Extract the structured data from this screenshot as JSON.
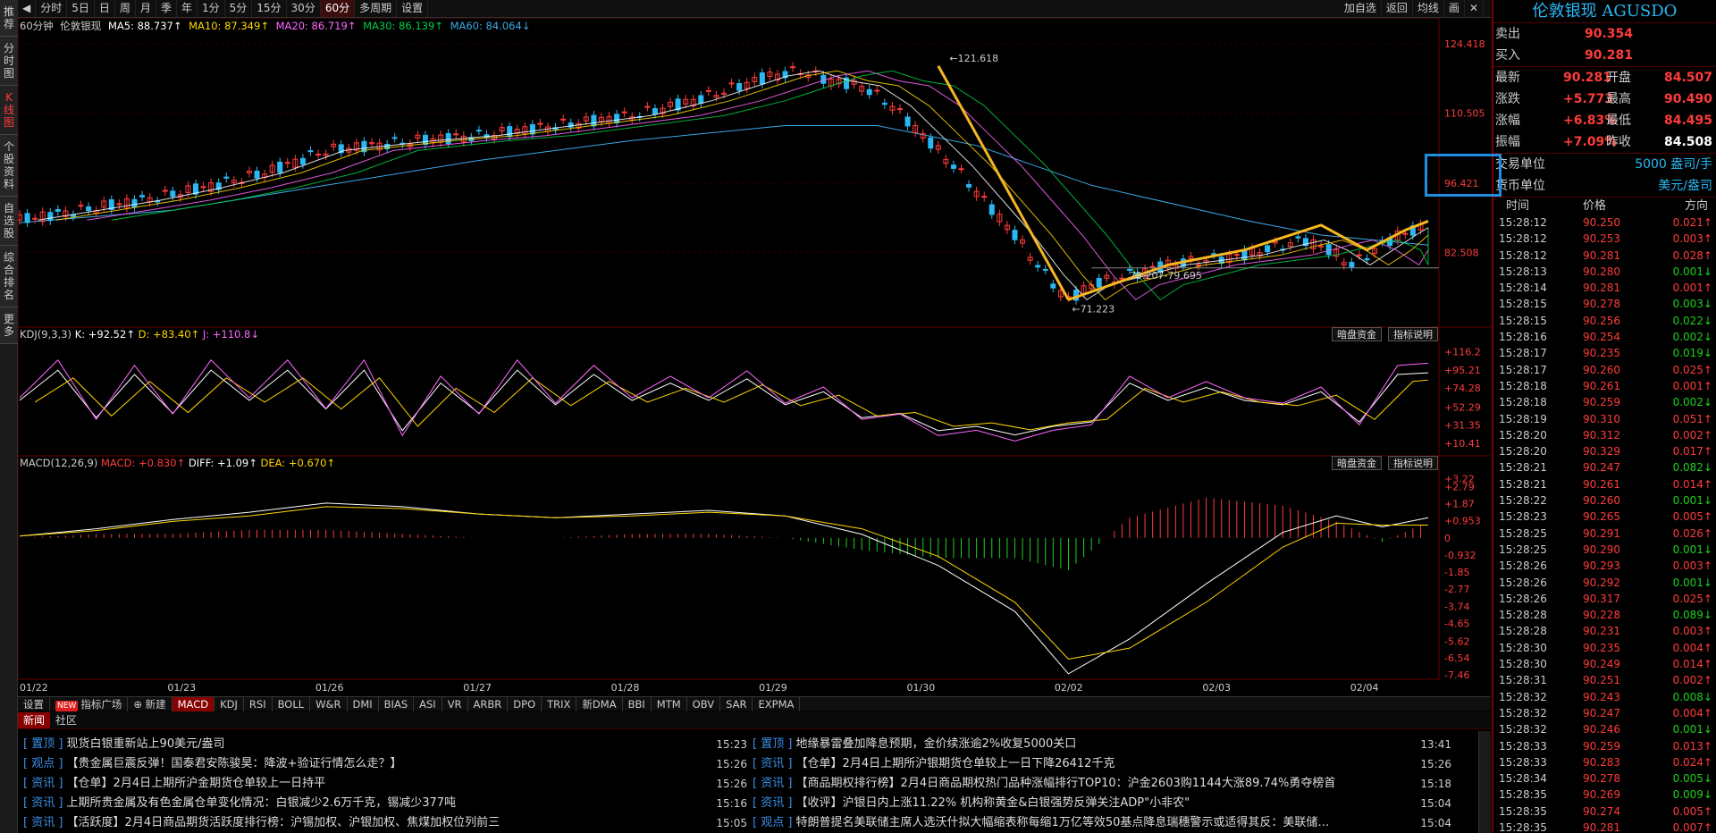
{
  "left_tabs": [
    "推荐",
    "分时图",
    "K线图",
    "个股资料",
    "自选股",
    "综合排名",
    "更多"
  ],
  "toolbar": {
    "buttons": [
      "分时",
      "5日",
      "日",
      "周",
      "月",
      "季",
      "年",
      "1分",
      "5分",
      "15分",
      "30分",
      "60分",
      "多周期",
      "设置"
    ],
    "active": "60分",
    "right_buttons": [
      "加自选",
      "返回",
      "均线",
      "画",
      "✕"
    ]
  },
  "info": {
    "period": "60分钟",
    "name": "伦敦银现",
    "ma5": "MA5: 88.737↑",
    "ma10": "MA10: 87.349↑",
    "ma20": "MA20: 86.719↑",
    "ma30": "MA30: 86.139↑",
    "ma60": "MA60: 84.064↓",
    "ma5_color": "#ffffff",
    "ma10_color": "#ffd700",
    "ma20_color": "#ff66ff",
    "ma30_color": "#00cc44",
    "ma60_color": "#3aa8e6"
  },
  "kdj": {
    "label": "KDJ(9,3,3)",
    "k": "K: +92.52↑",
    "d": "D: +83.40↑",
    "j": "J: +110.8↓",
    "btn1": "暗盘资金",
    "btn2": "指标说明"
  },
  "macd": {
    "label": "MACD(12,26,9)",
    "macd": "MACD: +0.830↑",
    "diff": "DIFF: +1.09↑",
    "dea": "DEA: +0.670↑",
    "btn1": "暗盘资金",
    "btn2": "指标说明"
  },
  "chart_data": {
    "type": "candlestick",
    "x_labels": [
      "01/22",
      "01/23",
      "01/26",
      "01/27",
      "01/28",
      "01/29",
      "01/30",
      "02/02",
      "02/03",
      "02/04"
    ],
    "price_axis": [
      "124.418",
      "110.505",
      "96.421",
      "82.508"
    ],
    "price_range": [
      67.5,
      127.5
    ],
    "annotations": {
      "high": "121.618",
      "low": "71.223",
      "range": "79.207-79.695"
    },
    "kdj_axis": [
      "+116.2",
      "+95.21",
      "+74.28",
      "+52.29",
      "+31.35",
      "+10.41"
    ],
    "macd_axis": [
      "+3.22",
      "+2.79",
      "+1.87",
      "+0.953",
      "0",
      "-0.932",
      "-1.85",
      "-2.77",
      "-3.74",
      "-4.65",
      "-5.62",
      "-6.54",
      "-7.46"
    ],
    "price_path": [
      [
        0,
        89
      ],
      [
        8,
        91
      ],
      [
        16,
        93
      ],
      [
        24,
        95.5
      ],
      [
        32,
        98.5
      ],
      [
        40,
        103
      ],
      [
        46,
        104
      ],
      [
        52,
        105
      ],
      [
        60,
        106
      ],
      [
        70,
        108
      ],
      [
        80,
        110
      ],
      [
        88,
        113
      ],
      [
        94,
        116
      ],
      [
        98,
        118
      ],
      [
        102,
        119
      ],
      [
        106,
        117
      ],
      [
        110,
        116
      ],
      [
        114,
        112
      ],
      [
        118,
        106
      ],
      [
        122,
        100
      ],
      [
        126,
        93
      ],
      [
        130,
        86
      ],
      [
        134,
        78
      ],
      [
        137,
        73
      ],
      [
        140,
        76
      ],
      [
        145,
        78
      ],
      [
        150,
        80
      ],
      [
        155,
        81
      ],
      [
        160,
        82
      ],
      [
        165,
        84
      ],
      [
        168,
        85
      ],
      [
        171,
        83
      ],
      [
        174,
        80
      ],
      [
        177,
        83
      ],
      [
        180,
        86
      ],
      [
        184,
        87.5
      ]
    ],
    "ma60_path": [
      [
        0,
        88.5
      ],
      [
        20,
        91
      ],
      [
        40,
        96
      ],
      [
        60,
        101
      ],
      [
        80,
        105
      ],
      [
        100,
        108
      ],
      [
        112,
        108
      ],
      [
        125,
        104
      ],
      [
        140,
        96
      ],
      [
        160,
        89
      ],
      [
        170,
        86
      ],
      [
        184,
        84
      ]
    ],
    "diff_path": [
      [
        0,
        0.1
      ],
      [
        10,
        0.5
      ],
      [
        20,
        1
      ],
      [
        30,
        1.4
      ],
      [
        40,
        1.9
      ],
      [
        50,
        1.7
      ],
      [
        60,
        1.3
      ],
      [
        70,
        1.1
      ],
      [
        80,
        1.3
      ],
      [
        90,
        1.5
      ],
      [
        100,
        1.2
      ],
      [
        110,
        0.2
      ],
      [
        120,
        -1.5
      ],
      [
        130,
        -4
      ],
      [
        137,
        -7.4
      ],
      [
        145,
        -5.5
      ],
      [
        155,
        -2.5
      ],
      [
        165,
        0.3
      ],
      [
        172,
        1.2
      ],
      [
        178,
        0.6
      ],
      [
        184,
        1.1
      ]
    ],
    "dea_path": [
      [
        0,
        0.1
      ],
      [
        10,
        0.4
      ],
      [
        20,
        0.9
      ],
      [
        30,
        1.2
      ],
      [
        40,
        1.7
      ],
      [
        50,
        1.6
      ],
      [
        60,
        1.3
      ],
      [
        70,
        1.1
      ],
      [
        80,
        1.2
      ],
      [
        90,
        1.4
      ],
      [
        100,
        1.2
      ],
      [
        110,
        0.5
      ],
      [
        120,
        -1
      ],
      [
        130,
        -3.5
      ],
      [
        137,
        -6.6
      ],
      [
        145,
        -6
      ],
      [
        155,
        -3.5
      ],
      [
        165,
        -0.5
      ],
      [
        172,
        0.8
      ],
      [
        178,
        0.7
      ],
      [
        184,
        0.7
      ]
    ],
    "k_path": [
      [
        0,
        60
      ],
      [
        5,
        95
      ],
      [
        10,
        40
      ],
      [
        15,
        90
      ],
      [
        20,
        45
      ],
      [
        25,
        95
      ],
      [
        30,
        60
      ],
      [
        35,
        95
      ],
      [
        40,
        50
      ],
      [
        45,
        95
      ],
      [
        50,
        25
      ],
      [
        55,
        80
      ],
      [
        60,
        45
      ],
      [
        65,
        95
      ],
      [
        70,
        55
      ],
      [
        75,
        90
      ],
      [
        80,
        60
      ],
      [
        85,
        80
      ],
      [
        90,
        60
      ],
      [
        95,
        85
      ],
      [
        100,
        55
      ],
      [
        105,
        70
      ],
      [
        110,
        40
      ],
      [
        115,
        45
      ],
      [
        120,
        25
      ],
      [
        125,
        30
      ],
      [
        130,
        20
      ],
      [
        135,
        30
      ],
      [
        140,
        35
      ],
      [
        145,
        80
      ],
      [
        150,
        60
      ],
      [
        155,
        75
      ],
      [
        160,
        60
      ],
      [
        165,
        55
      ],
      [
        170,
        70
      ],
      [
        175,
        35
      ],
      [
        180,
        90
      ],
      [
        184,
        92
      ]
    ]
  },
  "bottom_tabs": {
    "settings": "设置",
    "new_badge": "NEW",
    "indicator_square": "指标广场",
    "new_btn": "新建",
    "items": [
      "MACD",
      "KDJ",
      "RSI",
      "BOLL",
      "W&R",
      "DMI",
      "BIAS",
      "ASI",
      "VR",
      "ARBR",
      "DPO",
      "TRIX",
      "新DMA",
      "BBI",
      "MTM",
      "OBV",
      "SAR",
      "EXPMA"
    ],
    "active": "MACD"
  },
  "news_tabs": {
    "news": "新闻",
    "community": "社区"
  },
  "news_left": [
    {
      "tag": "[ 置顶 ]",
      "title": "现货白银重新站上90美元/盎司",
      "time": "15:23"
    },
    {
      "tag": "[ 观点 ]",
      "title": "【贵金属巨震反弹！国泰君安陈骏昊：降波+验证行情怎么走？】",
      "time": "15:26"
    },
    {
      "tag": "[ 资讯 ]",
      "title": "【仓单】2月4日上期所沪金期货仓单较上一日持平",
      "time": "15:26"
    },
    {
      "tag": "[ 资讯 ]",
      "title": "上期所贵金属及有色金属仓单变化情况：白银减少2.6万千克，锡减少377吨",
      "time": "15:16"
    },
    {
      "tag": "[ 资讯 ]",
      "title": "【活跃度】2月4日商品期货活跃度排行榜：沪锡加权、沪银加权、焦煤加权位列前三",
      "time": "15:05"
    }
  ],
  "news_right": [
    {
      "tag": "[ 置顶 ]",
      "title": "地缘暴雷叠加降息预期，金价续涨逾2%收复5000关口",
      "time": "13:41"
    },
    {
      "tag": "[ 资讯 ]",
      "title": "【仓单】2月4日上期所沪银期货仓单较上一日下降26412千克",
      "time": "15:26"
    },
    {
      "tag": "[ 资讯 ]",
      "title": "【商品期权排行榜】2月4日商品期权热门品种涨幅排行TOP10：沪金2603购1144大涨89.74%勇夺榜首",
      "time": "15:18"
    },
    {
      "tag": "[ 资讯 ]",
      "title": "【收评】沪银日内上涨11.22% 机构称黄金&白银强势反弹关注ADP\"小非农\"",
      "time": "15:04"
    },
    {
      "tag": "[ 观点 ]",
      "title": "特朗普提名美联储主席人选沃什拟大幅缩表称每缩1万亿等效50基点降息瑞穗警示或适得其反：美联储…",
      "time": "15:04"
    }
  ],
  "quote": {
    "title": "伦敦银现 AGUSDO",
    "sell_label": "卖出",
    "sell": "90.354",
    "buy_label": "买入",
    "buy": "90.281",
    "latest_label": "最新",
    "latest": "90.281",
    "open_label": "开盘",
    "open": "84.507",
    "change_label": "涨跌",
    "change": "+5.773",
    "high_label": "最高",
    "high": "90.490",
    "pct_label": "涨幅",
    "pct": "+6.83%",
    "low_label": "最低",
    "low": "84.495",
    "amp_label": "振幅",
    "amp": "+7.09%",
    "prev_label": "昨收",
    "prev": "84.508",
    "unit_label": "交易单位",
    "unit": "5000 盎司/手",
    "cur_label": "货币单位",
    "cur": "美元/盎司",
    "cols": [
      "时间",
      "价格",
      "方向"
    ]
  },
  "ticks": [
    [
      "15:28:12",
      "90.250",
      "0.021↑",
      "up"
    ],
    [
      "15:28:12",
      "90.253",
      "0.003↑",
      "up"
    ],
    [
      "15:28:12",
      "90.281",
      "0.028↑",
      "up"
    ],
    [
      "15:28:13",
      "90.280",
      "0.001↓",
      "down"
    ],
    [
      "15:28:14",
      "90.281",
      "0.001↑",
      "up"
    ],
    [
      "15:28:15",
      "90.278",
      "0.003↓",
      "down"
    ],
    [
      "15:28:15",
      "90.256",
      "0.022↓",
      "down"
    ],
    [
      "15:28:16",
      "90.254",
      "0.002↓",
      "down"
    ],
    [
      "15:28:17",
      "90.235",
      "0.019↓",
      "down"
    ],
    [
      "15:28:17",
      "90.260",
      "0.025↑",
      "up"
    ],
    [
      "15:28:18",
      "90.261",
      "0.001↑",
      "up"
    ],
    [
      "15:28:18",
      "90.259",
      "0.002↓",
      "down"
    ],
    [
      "15:28:19",
      "90.310",
      "0.051↑",
      "up"
    ],
    [
      "15:28:20",
      "90.312",
      "0.002↑",
      "up"
    ],
    [
      "15:28:20",
      "90.329",
      "0.017↑",
      "up"
    ],
    [
      "15:28:21",
      "90.247",
      "0.082↓",
      "down"
    ],
    [
      "15:28:21",
      "90.261",
      "0.014↑",
      "up"
    ],
    [
      "15:28:22",
      "90.260",
      "0.001↓",
      "down"
    ],
    [
      "15:28:23",
      "90.265",
      "0.005↑",
      "up"
    ],
    [
      "15:28:25",
      "90.291",
      "0.026↑",
      "up"
    ],
    [
      "15:28:25",
      "90.290",
      "0.001↓",
      "down"
    ],
    [
      "15:28:26",
      "90.293",
      "0.003↑",
      "up"
    ],
    [
      "15:28:26",
      "90.292",
      "0.001↓",
      "down"
    ],
    [
      "15:28:26",
      "90.317",
      "0.025↑",
      "up"
    ],
    [
      "15:28:28",
      "90.228",
      "0.089↓",
      "down"
    ],
    [
      "15:28:28",
      "90.231",
      "0.003↑",
      "up"
    ],
    [
      "15:28:30",
      "90.235",
      "0.004↑",
      "up"
    ],
    [
      "15:28:30",
      "90.249",
      "0.014↑",
      "up"
    ],
    [
      "15:28:31",
      "90.251",
      "0.002↑",
      "up"
    ],
    [
      "15:28:32",
      "90.243",
      "0.008↓",
      "down"
    ],
    [
      "15:28:32",
      "90.247",
      "0.004↑",
      "up"
    ],
    [
      "15:28:32",
      "90.246",
      "0.001↓",
      "down"
    ],
    [
      "15:28:33",
      "90.259",
      "0.013↑",
      "up"
    ],
    [
      "15:28:33",
      "90.283",
      "0.024↑",
      "up"
    ],
    [
      "15:28:34",
      "90.278",
      "0.005↓",
      "down"
    ],
    [
      "15:28:35",
      "90.269",
      "0.009↓",
      "down"
    ],
    [
      "15:28:35",
      "90.274",
      "0.005↑",
      "up"
    ],
    [
      "15:28:35",
      "90.281",
      "0.007↑",
      "up"
    ]
  ]
}
